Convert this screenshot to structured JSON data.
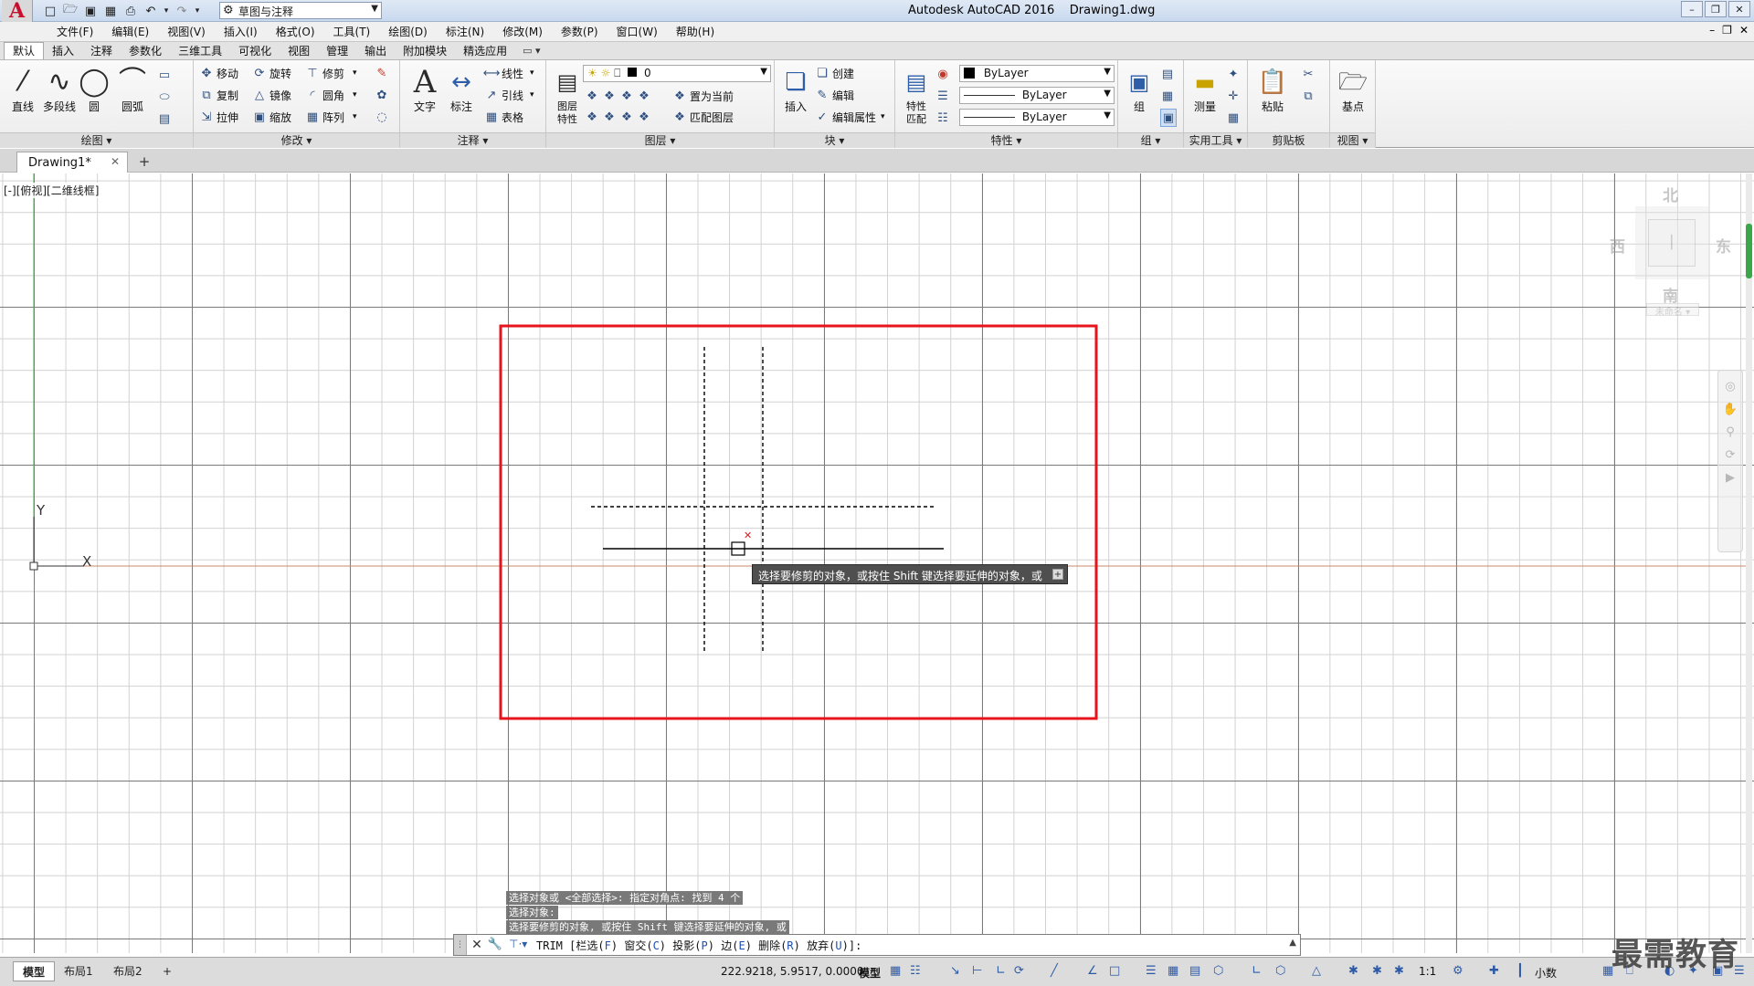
{
  "titlebar": {
    "app_name": "Autodesk AutoCAD 2016",
    "file_name": "Drawing1.dwg",
    "workspace": "草图与注释"
  },
  "menu": [
    "文件(F)",
    "编辑(E)",
    "视图(V)",
    "插入(I)",
    "格式(O)",
    "工具(T)",
    "绘图(D)",
    "标注(N)",
    "修改(M)",
    "参数(P)",
    "窗口(W)",
    "帮助(H)"
  ],
  "ribbon_tabs": [
    "默认",
    "插入",
    "注释",
    "参数化",
    "三维工具",
    "可视化",
    "视图",
    "管理",
    "输出",
    "附加模块",
    "精选应用"
  ],
  "panels": {
    "draw": {
      "title": "绘图",
      "line": "直线",
      "polyline": "多段线",
      "circle": "圆",
      "arc": "圆弧"
    },
    "modify": {
      "title": "修改",
      "move": "移动",
      "rotate": "旋转",
      "trim": "修剪",
      "copy": "复制",
      "mirror": "镜像",
      "fillet": "圆角",
      "stretch": "拉伸",
      "scale": "缩放",
      "array": "阵列"
    },
    "annotation": {
      "title": "注释",
      "text": "文字",
      "dimension": "标注",
      "linear": "线性",
      "leader": "引线",
      "table": "表格"
    },
    "layers": {
      "title": "图层",
      "layer_props": "图层\n特性",
      "current_layer": "0",
      "set_current": "置为当前",
      "match_layer": "匹配图层"
    },
    "block": {
      "title": "块",
      "insert": "插入",
      "create": "创建",
      "edit": "编辑",
      "edit_attr": "编辑属性"
    },
    "properties": {
      "title": "特性",
      "match": "特性\n匹配",
      "color": "ByLayer",
      "linetype": "ByLayer",
      "lineweight": "ByLayer"
    },
    "groups": {
      "title": "组",
      "group": "组"
    },
    "utilities": {
      "title": "实用工具",
      "measure": "测量"
    },
    "clipboard": {
      "title": "剪贴板",
      "paste": "粘贴"
    },
    "view": {
      "title": "视图",
      "base": "基点"
    }
  },
  "file_tab": {
    "label": "Drawing1*"
  },
  "viewport": {
    "label": "[-][俯视][二维线框]"
  },
  "viewcube": {
    "north": "北",
    "south": "南",
    "east": "东",
    "west": "西",
    "wcs": "未命名"
  },
  "ucs": {
    "x_label": "X",
    "y_label": "Y"
  },
  "tooltip": {
    "text": "选择要修剪的对象，或按住 Shift 键选择要延伸的对象，或"
  },
  "command_history": [
    "选择对象或 <全部选择>:  指定对角点: 找到 4 个",
    "选择对象:",
    "选择要修剪的对象, 或按住 Shift 键选择要延伸的对象, 或"
  ],
  "command_line": {
    "command": "TRIM",
    "options": [
      {
        "label": "栏选",
        "key": "F"
      },
      {
        "label": "窗交",
        "key": "C"
      },
      {
        "label": "投影",
        "key": "P"
      },
      {
        "label": "边",
        "key": "E"
      },
      {
        "label": "删除",
        "key": "R"
      },
      {
        "label": "放弃",
        "key": "U"
      }
    ],
    "suffix": ":"
  },
  "statusbar": {
    "layouts": [
      "模型",
      "布局1",
      "布局2"
    ],
    "coords": "222.9218, 5.9517, 0.0000",
    "model": "模型",
    "scale": "1:1",
    "units": "小数"
  },
  "watermark": "最需教育",
  "colors": {
    "highlight_rect": "#e8141b",
    "ucs_x_axis": "#c88a6a",
    "ucs_y_axis": "#5aa65a",
    "cursor_mark": "#d62020"
  }
}
